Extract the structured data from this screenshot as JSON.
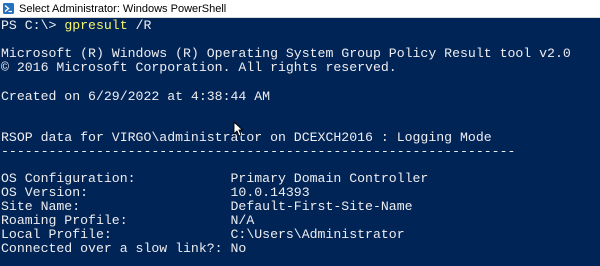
{
  "window": {
    "title": "Select Administrator: Windows PowerShell"
  },
  "console": {
    "prompt": {
      "prefix": "PS C:\\> ",
      "command": "gpresult",
      "argument": " /R"
    },
    "lines": [
      "Microsoft (R) Windows (R) Operating System Group Policy Result tool v2.0",
      "© 2016 Microsoft Corporation. All rights reserved.",
      "Created on 6/29/2022 at 4:38:44 AM",
      "RSOP data for VIRGO\\administrator on DCEXCH2016 : Logging Mode",
      "-----------------------------------------------------------------",
      "OS Configuration:            Primary Domain Controller",
      "OS Version:                  10.0.14393",
      "Site Name:                   Default-First-Site-Name",
      "Roaming Profile:             N/A",
      "Local Profile:               C:\\Users\\Administrator",
      "Connected over a slow link?: No"
    ]
  },
  "colors": {
    "console_background": "#012456",
    "console_text": "#eeedf0",
    "command_highlight": "#f6f56e",
    "titlebar_background": "#ffffff"
  },
  "icons": {
    "app_icon": "powershell-icon",
    "pointer": "mouse-pointer-icon"
  }
}
